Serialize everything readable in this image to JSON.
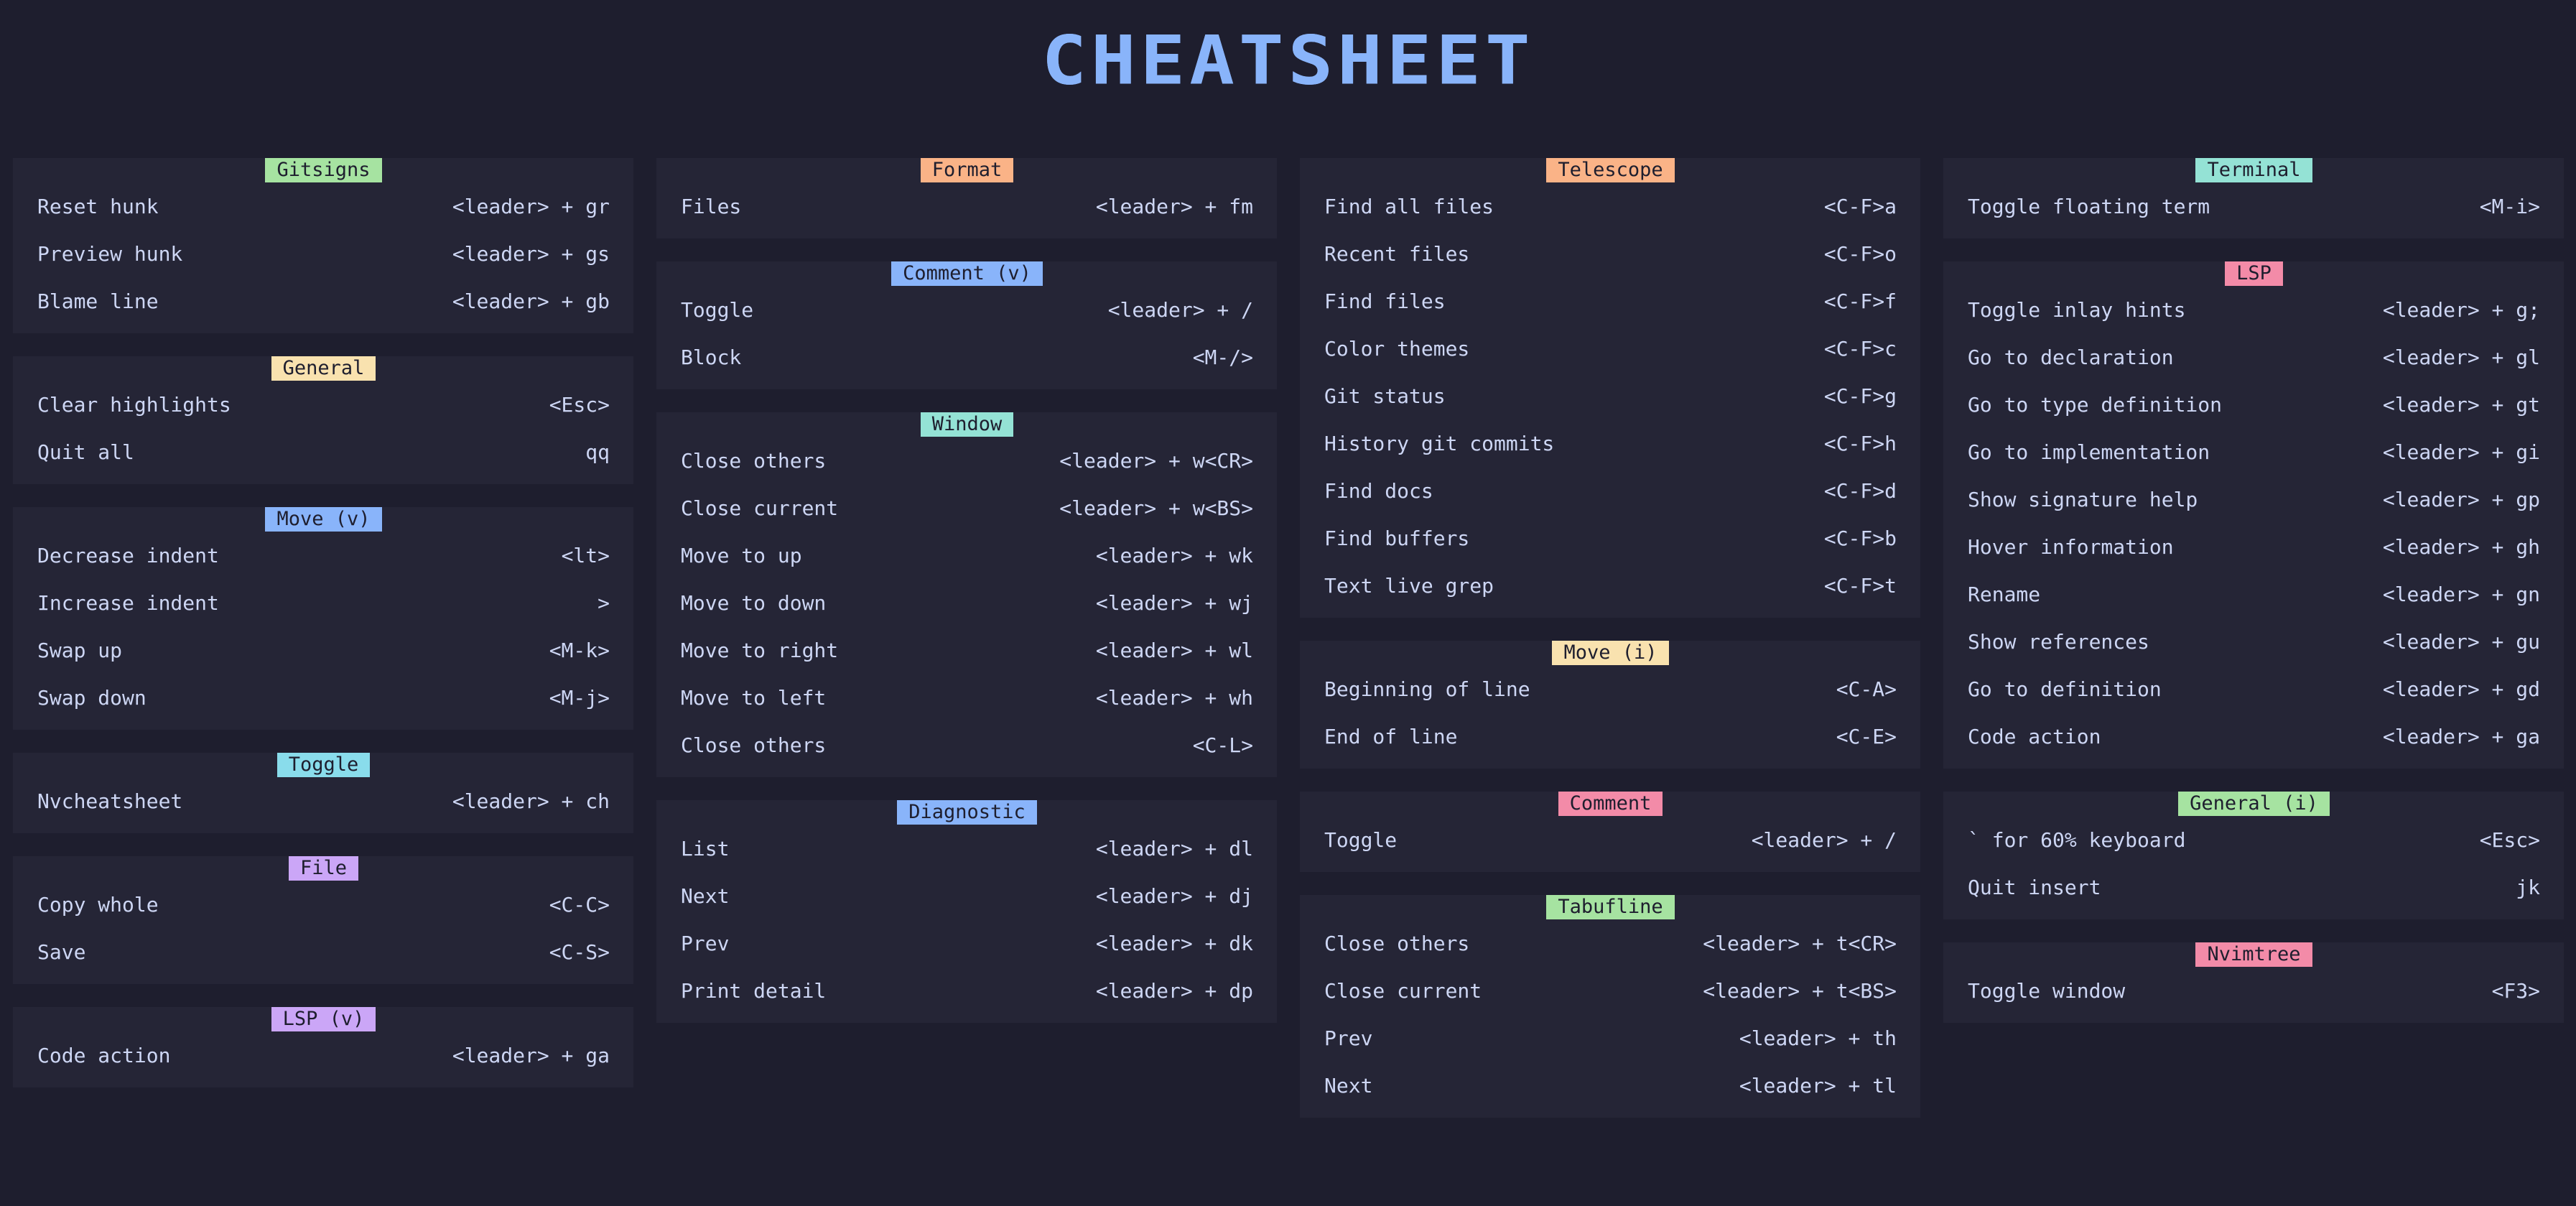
{
  "title": "CHEATSHEET",
  "colors": {
    "background": "#1e1e2e",
    "card": "#252536",
    "text": "#cdd6f4",
    "title": "#89b4fa",
    "green": "#a6e3a1",
    "yellow": "#f9e2af",
    "blue": "#89b4fa",
    "cyan": "#89dceb",
    "mauve": "#cba6f7",
    "peach": "#fab387",
    "teal": "#94e2d5",
    "pink": "#f38ba8"
  },
  "columns": [
    {
      "cards": [
        {
          "name": "Gitsigns",
          "color": "#a6e3a1",
          "rows": [
            {
              "label": "Reset hunk",
              "key": "<leader> + gr"
            },
            {
              "label": "Preview hunk",
              "key": "<leader> + gs"
            },
            {
              "label": "Blame line",
              "key": "<leader> + gb"
            }
          ]
        },
        {
          "name": "General",
          "color": "#f9e2af",
          "rows": [
            {
              "label": "Clear highlights",
              "key": "<Esc>"
            },
            {
              "label": "Quit all",
              "key": "qq"
            }
          ]
        },
        {
          "name": "Move (v)",
          "color": "#89b4fa",
          "rows": [
            {
              "label": "Decrease indent",
              "key": "<lt>"
            },
            {
              "label": "Increase indent",
              "key": ">"
            },
            {
              "label": "Swap up",
              "key": "<M-k>"
            },
            {
              "label": "Swap down",
              "key": "<M-j>"
            }
          ]
        },
        {
          "name": "Toggle",
          "color": "#89dceb",
          "rows": [
            {
              "label": "Nvcheatsheet",
              "key": "<leader> + ch"
            }
          ]
        },
        {
          "name": "File",
          "color": "#cba6f7",
          "rows": [
            {
              "label": "Copy whole",
              "key": "<C-C>"
            },
            {
              "label": "Save",
              "key": "<C-S>"
            }
          ]
        },
        {
          "name": "LSP (v)",
          "color": "#cba6f7",
          "rows": [
            {
              "label": "Code action",
              "key": "<leader> + ga"
            }
          ]
        }
      ]
    },
    {
      "cards": [
        {
          "name": "Format",
          "color": "#fab387",
          "rows": [
            {
              "label": "Files",
              "key": "<leader> + fm"
            }
          ]
        },
        {
          "name": "Comment (v)",
          "color": "#89b4fa",
          "rows": [
            {
              "label": "Toggle",
              "key": "<leader> + /"
            },
            {
              "label": "Block",
              "key": "<M-/>"
            }
          ]
        },
        {
          "name": "Window",
          "color": "#94e2d5",
          "rows": [
            {
              "label": "Close others",
              "key": "<leader> + w<CR>"
            },
            {
              "label": "Close current",
              "key": "<leader> + w<BS>"
            },
            {
              "label": "Move to up",
              "key": "<leader> + wk"
            },
            {
              "label": "Move to down",
              "key": "<leader> + wj"
            },
            {
              "label": "Move to right",
              "key": "<leader> + wl"
            },
            {
              "label": "Move to left",
              "key": "<leader> + wh"
            },
            {
              "label": "Close others",
              "key": "<C-L>"
            }
          ]
        },
        {
          "name": "Diagnostic",
          "color": "#89b4fa",
          "rows": [
            {
              "label": "List",
              "key": "<leader> + dl"
            },
            {
              "label": "Next",
              "key": "<leader> + dj"
            },
            {
              "label": "Prev",
              "key": "<leader> + dk"
            },
            {
              "label": "Print detail",
              "key": "<leader> + dp"
            }
          ]
        }
      ]
    },
    {
      "cards": [
        {
          "name": "Telescope",
          "color": "#fab387",
          "rows": [
            {
              "label": "Find all files",
              "key": "<C-F>a"
            },
            {
              "label": "Recent files",
              "key": "<C-F>o"
            },
            {
              "label": "Find files",
              "key": "<C-F>f"
            },
            {
              "label": "Color themes",
              "key": "<C-F>c"
            },
            {
              "label": "Git status",
              "key": "<C-F>g"
            },
            {
              "label": "History git commits",
              "key": "<C-F>h"
            },
            {
              "label": "Find docs",
              "key": "<C-F>d"
            },
            {
              "label": "Find buffers",
              "key": "<C-F>b"
            },
            {
              "label": "Text live grep",
              "key": "<C-F>t"
            }
          ]
        },
        {
          "name": "Move (i)",
          "color": "#f9e2af",
          "rows": [
            {
              "label": "Beginning of line",
              "key": "<C-A>"
            },
            {
              "label": "End of line",
              "key": "<C-E>"
            }
          ]
        },
        {
          "name": "Comment",
          "color": "#f38ba8",
          "rows": [
            {
              "label": "Toggle",
              "key": "<leader> + /"
            }
          ]
        },
        {
          "name": "Tabufline",
          "color": "#a6e3a1",
          "rows": [
            {
              "label": "Close others",
              "key": "<leader> + t<CR>"
            },
            {
              "label": "Close current",
              "key": "<leader> + t<BS>"
            },
            {
              "label": "Prev",
              "key": "<leader> + th"
            },
            {
              "label": "Next",
              "key": "<leader> + tl"
            }
          ]
        }
      ]
    },
    {
      "cards": [
        {
          "name": "Terminal",
          "color": "#94e2d5",
          "rows": [
            {
              "label": "Toggle floating term",
              "key": "<M-i>"
            }
          ]
        },
        {
          "name": "LSP",
          "color": "#f38ba8",
          "rows": [
            {
              "label": "Toggle inlay hints",
              "key": "<leader> + g;"
            },
            {
              "label": "Go to declaration",
              "key": "<leader> + gl"
            },
            {
              "label": "Go to type definition",
              "key": "<leader> + gt"
            },
            {
              "label": "Go to implementation",
              "key": "<leader> + gi"
            },
            {
              "label": "Show signature help",
              "key": "<leader> + gp"
            },
            {
              "label": "Hover information",
              "key": "<leader> + gh"
            },
            {
              "label": "Rename",
              "key": "<leader> + gn"
            },
            {
              "label": "Show references",
              "key": "<leader> + gu"
            },
            {
              "label": "Go to definition",
              "key": "<leader> + gd"
            },
            {
              "label": "Code action",
              "key": "<leader> + ga"
            }
          ]
        },
        {
          "name": "General (i)",
          "color": "#a6e3a1",
          "rows": [
            {
              "label": "` for 60% keyboard",
              "key": "<Esc>"
            },
            {
              "label": "Quit insert",
              "key": "jk"
            }
          ]
        },
        {
          "name": "Nvimtree",
          "color": "#f38ba8",
          "rows": [
            {
              "label": "Toggle window",
              "key": "<F3>"
            }
          ]
        }
      ]
    }
  ]
}
